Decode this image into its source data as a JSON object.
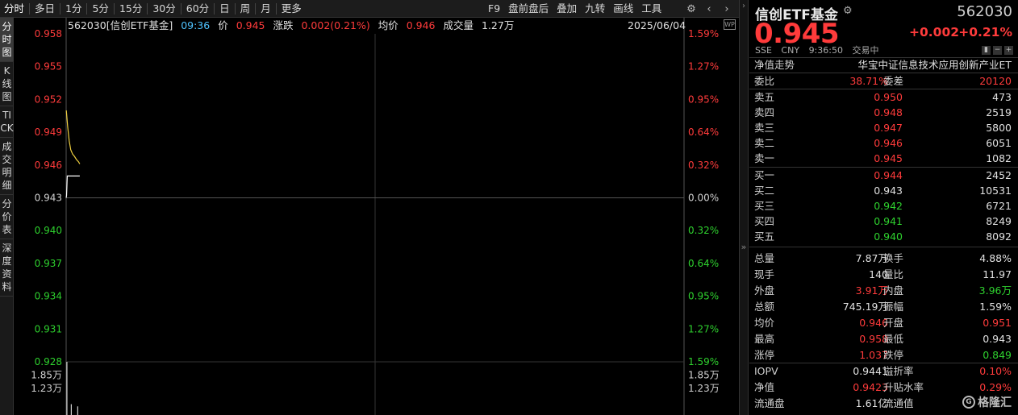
{
  "toolbar": {
    "left": [
      "分时",
      "多日",
      "1分",
      "5分",
      "15分",
      "30分",
      "60分",
      "日",
      "周",
      "月",
      "更多"
    ],
    "right": [
      "F9",
      "盘前盘后",
      "叠加",
      "九转",
      "画线",
      "工具"
    ],
    "icons": [
      "gear-icon",
      "chevron-left-icon",
      "chevron-right-icon"
    ]
  },
  "left_tabs": [
    "分时图",
    "K线图",
    "TICK",
    "成交明细",
    "分价表",
    "深度资料"
  ],
  "chart_header": {
    "code_name": "562030[信创ETF基金]",
    "time": "09:36",
    "price_label": "价",
    "price": "0.945",
    "change_label": "涨跌",
    "change": "0.002(0.21%)",
    "avg_label": "均价",
    "avg": "0.946",
    "volume_label": "成交量",
    "volume": "1.27万",
    "date": "2025/06/04",
    "wp_icon": "WP"
  },
  "chart_data": {
    "type": "line",
    "y_left_ticks": [
      "0.958",
      "0.955",
      "0.952",
      "0.949",
      "0.946",
      "0.943",
      "0.940",
      "0.937",
      "0.934",
      "0.931",
      "0.928"
    ],
    "y_right_ticks": [
      "1.59%",
      "1.27%",
      "0.95%",
      "0.64%",
      "0.32%",
      "0.00%",
      "0.32%",
      "0.64%",
      "0.95%",
      "1.27%",
      "1.59%"
    ],
    "ylim": [
      0.928,
      0.958
    ],
    "prev_close": 0.943,
    "vol_left_ticks": [
      "1.85万",
      "1.23万"
    ],
    "vol_right_ticks": [
      "1.85万",
      "1.23万"
    ],
    "vol_ylim": [
      0,
      2.46
    ],
    "total_minutes": 240,
    "series": [
      {
        "name": "价",
        "color": "#ffffff",
        "points": [
          [
            0,
            0.943
          ],
          [
            0.15,
            0.9432
          ],
          [
            0.3,
            0.9442
          ],
          [
            0.45,
            0.945
          ],
          [
            1,
            0.945
          ],
          [
            1.7,
            0.945
          ],
          [
            2.5,
            0.945
          ],
          [
            3.5,
            0.945
          ],
          [
            4.5,
            0.945
          ],
          [
            5.3,
            0.945
          ]
        ]
      },
      {
        "name": "均价",
        "color": "#f0d040",
        "points": [
          [
            0.05,
            0.951
          ],
          [
            0.6,
            0.9495
          ],
          [
            1.2,
            0.9482
          ],
          [
            1.8,
            0.9474
          ],
          [
            2.5,
            0.947
          ],
          [
            3.2,
            0.9468
          ],
          [
            4,
            0.9465
          ],
          [
            4.8,
            0.9463
          ],
          [
            5.3,
            0.9461
          ]
        ]
      }
    ],
    "volume_bars": [
      [
        0.3,
        2.46
      ],
      [
        2.0,
        0.5
      ],
      [
        4.5,
        0.4
      ]
    ]
  },
  "panel": {
    "name": "信创ETF基金",
    "code": "562030",
    "price": "0.945",
    "change": "+0.002",
    "change_pct": "+0.21%",
    "sub": [
      "SSE",
      "CNY",
      "9:36:50",
      "交易中"
    ],
    "nav_label": "净值走势",
    "full_name": "华宝中证信息技术应用创新产业ET",
    "weibi_label": "委比",
    "weibi": "38.71%",
    "weicha_label": "委差",
    "weicha": "20120",
    "asks": [
      {
        "label": "卖五",
        "price": "0.950",
        "vol": "473"
      },
      {
        "label": "卖四",
        "price": "0.948",
        "vol": "2519"
      },
      {
        "label": "卖三",
        "price": "0.947",
        "vol": "5800"
      },
      {
        "label": "卖二",
        "price": "0.946",
        "vol": "6051"
      },
      {
        "label": "卖一",
        "price": "0.945",
        "vol": "1082"
      }
    ],
    "bids": [
      {
        "label": "买一",
        "price": "0.944",
        "vol": "2452"
      },
      {
        "label": "买二",
        "price": "0.943",
        "vol": "10531"
      },
      {
        "label": "买三",
        "price": "0.942",
        "vol": "6721"
      },
      {
        "label": "买四",
        "price": "0.941",
        "vol": "8249"
      },
      {
        "label": "买五",
        "price": "0.940",
        "vol": "8092"
      }
    ],
    "stats": [
      {
        "l1": "总量",
        "v1": "7.87万",
        "c1": "white",
        "l2": "换手",
        "v2": "4.88%",
        "c2": "white"
      },
      {
        "l1": "现手",
        "v1": "140",
        "c1": "white",
        "l2": "量比",
        "v2": "11.97",
        "c2": "white"
      },
      {
        "l1": "外盘",
        "v1": "3.91万",
        "c1": "red",
        "l2": "内盘",
        "v2": "3.96万",
        "c2": "green"
      },
      {
        "l1": "总额",
        "v1": "745.19万",
        "c1": "white",
        "l2": "振幅",
        "v2": "1.59%",
        "c2": "white"
      },
      {
        "l1": "均价",
        "v1": "0.946",
        "c1": "red",
        "l2": "开盘",
        "v2": "0.951",
        "c2": "red"
      },
      {
        "l1": "最高",
        "v1": "0.958",
        "c1": "red",
        "l2": "最低",
        "v2": "0.943",
        "c2": "white"
      },
      {
        "l1": "涨停",
        "v1": "1.037",
        "c1": "red",
        "l2": "跌停",
        "v2": "0.849",
        "c2": "green"
      }
    ],
    "iopv": [
      {
        "l1": "IOPV",
        "v1": "0.9441",
        "c1": "white",
        "l2": "溢折率",
        "v2": "0.10%",
        "c2": "red"
      },
      {
        "l1": "净值",
        "v1": "0.9423",
        "c1": "red",
        "l2": "升贴水率",
        "v2": "0.29%",
        "c2": "red"
      },
      {
        "l1": "流通盘",
        "v1": "1.61亿",
        "c1": "white",
        "l2": "流通值",
        "v2": "",
        "c2": "white"
      }
    ],
    "watermark": "格隆汇"
  }
}
